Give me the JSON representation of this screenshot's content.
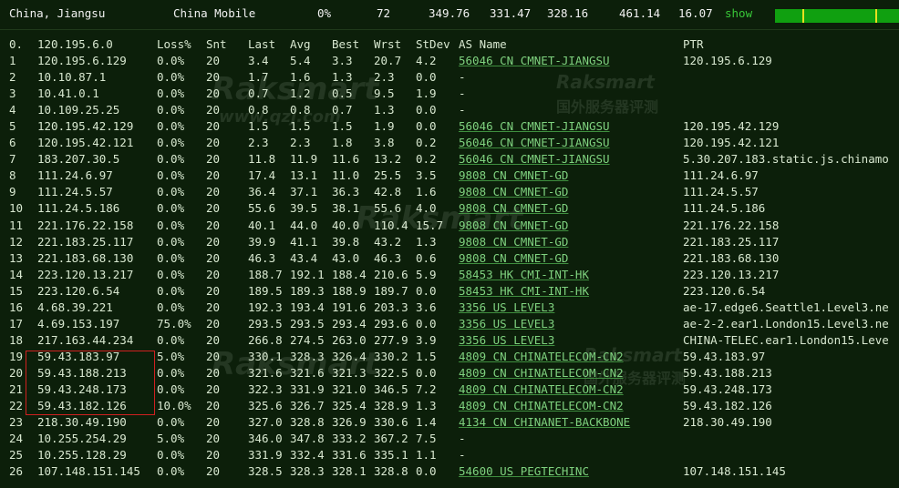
{
  "summary": {
    "location": "China, Jiangsu",
    "isp": "China Mobile",
    "loss": "0%",
    "snt": "72",
    "v1": "349.76",
    "v2": "331.47",
    "v3": "328.16",
    "v4": "461.14",
    "v5": "16.07",
    "show": "show"
  },
  "header": {
    "idx": "0.",
    "host": "120.195.6.0",
    "loss": "Loss%",
    "snt": "Snt",
    "last": "Last",
    "avg": "Avg",
    "best": "Best",
    "wrst": "Wrst",
    "stdev": "StDev",
    "asname": "AS Name",
    "ptr": "PTR"
  },
  "watermark": {
    "brand": "Raksmart",
    "cn": "国外服务器评测",
    "url": "www.qzj.com"
  },
  "rows": [
    {
      "idx": "1",
      "host": "120.195.6.129",
      "loss": "0.0%",
      "snt": "20",
      "last": "3.4",
      "avg": "5.4",
      "best": "3.3",
      "wrst": "20.7",
      "stdev": "4.2",
      "as": "56046 CN CMNET-JIANGSU",
      "ptr": "120.195.6.129"
    },
    {
      "idx": "2",
      "host": "10.10.87.1",
      "loss": "0.0%",
      "snt": "20",
      "last": "1.7",
      "avg": "1.6",
      "best": "1.3",
      "wrst": "2.3",
      "stdev": "0.0",
      "as": "-",
      "ptr": ""
    },
    {
      "idx": "3",
      "host": "10.41.0.1",
      "loss": "0.0%",
      "snt": "20",
      "last": "0.7",
      "avg": "1.2",
      "best": "0.5",
      "wrst": "9.5",
      "stdev": "1.9",
      "as": "-",
      "ptr": ""
    },
    {
      "idx": "4",
      "host": "10.109.25.25",
      "loss": "0.0%",
      "snt": "20",
      "last": "0.8",
      "avg": "0.8",
      "best": "0.7",
      "wrst": "1.3",
      "stdev": "0.0",
      "as": "-",
      "ptr": ""
    },
    {
      "idx": "5",
      "host": "120.195.42.129",
      "loss": "0.0%",
      "snt": "20",
      "last": "1.5",
      "avg": "1.5",
      "best": "1.5",
      "wrst": "1.9",
      "stdev": "0.0",
      "as": "56046 CN CMNET-JIANGSU",
      "ptr": "120.195.42.129"
    },
    {
      "idx": "6",
      "host": "120.195.42.121",
      "loss": "0.0%",
      "snt": "20",
      "last": "2.3",
      "avg": "2.3",
      "best": "1.8",
      "wrst": "3.8",
      "stdev": "0.2",
      "as": "56046 CN CMNET-JIANGSU",
      "ptr": "120.195.42.121"
    },
    {
      "idx": "7",
      "host": "183.207.30.5",
      "loss": "0.0%",
      "snt": "20",
      "last": "11.8",
      "avg": "11.9",
      "best": "11.6",
      "wrst": "13.2",
      "stdev": "0.2",
      "as": "56046 CN CMNET-JIANGSU",
      "ptr": "5.30.207.183.static.js.chinamo"
    },
    {
      "idx": "8",
      "host": "111.24.6.97",
      "loss": "0.0%",
      "snt": "20",
      "last": "17.4",
      "avg": "13.1",
      "best": "11.0",
      "wrst": "25.5",
      "stdev": "3.5",
      "as": "9808 CN CMNET-GD",
      "ptr": "111.24.6.97"
    },
    {
      "idx": "9",
      "host": "111.24.5.57",
      "loss": "0.0%",
      "snt": "20",
      "last": "36.4",
      "avg": "37.1",
      "best": "36.3",
      "wrst": "42.8",
      "stdev": "1.6",
      "as": "9808 CN CMNET-GD",
      "ptr": "111.24.5.57"
    },
    {
      "idx": "10",
      "host": "111.24.5.186",
      "loss": "0.0%",
      "snt": "20",
      "last": "55.6",
      "avg": "39.5",
      "best": "38.1",
      "wrst": "55.6",
      "stdev": "4.0",
      "as": "9808 CN CMNET-GD",
      "ptr": "111.24.5.186"
    },
    {
      "idx": "11",
      "host": "221.176.22.158",
      "loss": "0.0%",
      "snt": "20",
      "last": "40.1",
      "avg": "44.0",
      "best": "40.0",
      "wrst": "110.4",
      "stdev": "15.7",
      "as": "9808 CN CMNET-GD",
      "ptr": "221.176.22.158"
    },
    {
      "idx": "12",
      "host": "221.183.25.117",
      "loss": "0.0%",
      "snt": "20",
      "last": "39.9",
      "avg": "41.1",
      "best": "39.8",
      "wrst": "43.2",
      "stdev": "1.3",
      "as": "9808 CN CMNET-GD",
      "ptr": "221.183.25.117"
    },
    {
      "idx": "13",
      "host": "221.183.68.130",
      "loss": "0.0%",
      "snt": "20",
      "last": "46.3",
      "avg": "43.4",
      "best": "43.0",
      "wrst": "46.3",
      "stdev": "0.6",
      "as": "9808 CN CMNET-GD",
      "ptr": "221.183.68.130"
    },
    {
      "idx": "14",
      "host": "223.120.13.217",
      "loss": "0.0%",
      "snt": "20",
      "last": "188.7",
      "avg": "192.1",
      "best": "188.4",
      "wrst": "210.6",
      "stdev": "5.9",
      "as": "58453 HK CMI-INT-HK",
      "ptr": "223.120.13.217"
    },
    {
      "idx": "15",
      "host": "223.120.6.54",
      "loss": "0.0%",
      "snt": "20",
      "last": "189.5",
      "avg": "189.3",
      "best": "188.9",
      "wrst": "189.7",
      "stdev": "0.0",
      "as": "58453 HK CMI-INT-HK",
      "ptr": "223.120.6.54"
    },
    {
      "idx": "16",
      "host": "4.68.39.221",
      "loss": "0.0%",
      "snt": "20",
      "last": "192.3",
      "avg": "193.4",
      "best": "191.6",
      "wrst": "203.3",
      "stdev": "3.6",
      "as": "3356 US LEVEL3",
      "ptr": "ae-17.edge6.Seattle1.Level3.ne"
    },
    {
      "idx": "17",
      "host": "4.69.153.197",
      "loss": "75.0%",
      "snt": "20",
      "last": "293.5",
      "avg": "293.5",
      "best": "293.4",
      "wrst": "293.6",
      "stdev": "0.0",
      "as": "3356 US LEVEL3",
      "ptr": "ae-2-2.ear1.London15.Level3.ne"
    },
    {
      "idx": "18",
      "host": "217.163.44.234",
      "loss": "0.0%",
      "snt": "20",
      "last": "266.8",
      "avg": "274.5",
      "best": "263.0",
      "wrst": "277.9",
      "stdev": "3.9",
      "as": "3356 US LEVEL3",
      "ptr": "CHINA-TELEC.ear1.London15.Leve"
    },
    {
      "idx": "19",
      "host": "59.43.183.97",
      "loss": "5.0%",
      "snt": "20",
      "last": "330.1",
      "avg": "328.3",
      "best": "326.4",
      "wrst": "330.2",
      "stdev": "1.5",
      "as": "4809 CN CHINATELECOM-CN2",
      "ptr": "59.43.183.97"
    },
    {
      "idx": "20",
      "host": "59.43.188.213",
      "loss": "0.0%",
      "snt": "20",
      "last": "321.6",
      "avg": "321.6",
      "best": "321.3",
      "wrst": "322.5",
      "stdev": "0.0",
      "as": "4809 CN CHINATELECOM-CN2",
      "ptr": "59.43.188.213"
    },
    {
      "idx": "21",
      "host": "59.43.248.173",
      "loss": "0.0%",
      "snt": "20",
      "last": "322.3",
      "avg": "331.9",
      "best": "321.0",
      "wrst": "346.5",
      "stdev": "7.2",
      "as": "4809 CN CHINATELECOM-CN2",
      "ptr": "59.43.248.173"
    },
    {
      "idx": "22",
      "host": "59.43.182.126",
      "loss": "10.0%",
      "snt": "20",
      "last": "325.6",
      "avg": "326.7",
      "best": "325.4",
      "wrst": "328.9",
      "stdev": "1.3",
      "as": "4809 CN CHINATELECOM-CN2",
      "ptr": "59.43.182.126"
    },
    {
      "idx": "23",
      "host": "218.30.49.190",
      "loss": "0.0%",
      "snt": "20",
      "last": "327.0",
      "avg": "328.8",
      "best": "326.9",
      "wrst": "330.6",
      "stdev": "1.4",
      "as": "4134 CN CHINANET-BACKBONE",
      "ptr": "218.30.49.190"
    },
    {
      "idx": "24",
      "host": "10.255.254.29",
      "loss": "5.0%",
      "snt": "20",
      "last": "346.0",
      "avg": "347.8",
      "best": "333.2",
      "wrst": "367.2",
      "stdev": "7.5",
      "as": "-",
      "ptr": ""
    },
    {
      "idx": "25",
      "host": "10.255.128.29",
      "loss": "0.0%",
      "snt": "20",
      "last": "331.9",
      "avg": "332.4",
      "best": "331.6",
      "wrst": "335.1",
      "stdev": "1.1",
      "as": "-",
      "ptr": ""
    },
    {
      "idx": "26",
      "host": "107.148.151.145",
      "loss": "0.0%",
      "snt": "20",
      "last": "328.5",
      "avg": "328.3",
      "best": "328.1",
      "wrst": "328.8",
      "stdev": "0.0",
      "as": "54600 US PEGTECHINC",
      "ptr": "107.148.151.145"
    }
  ]
}
